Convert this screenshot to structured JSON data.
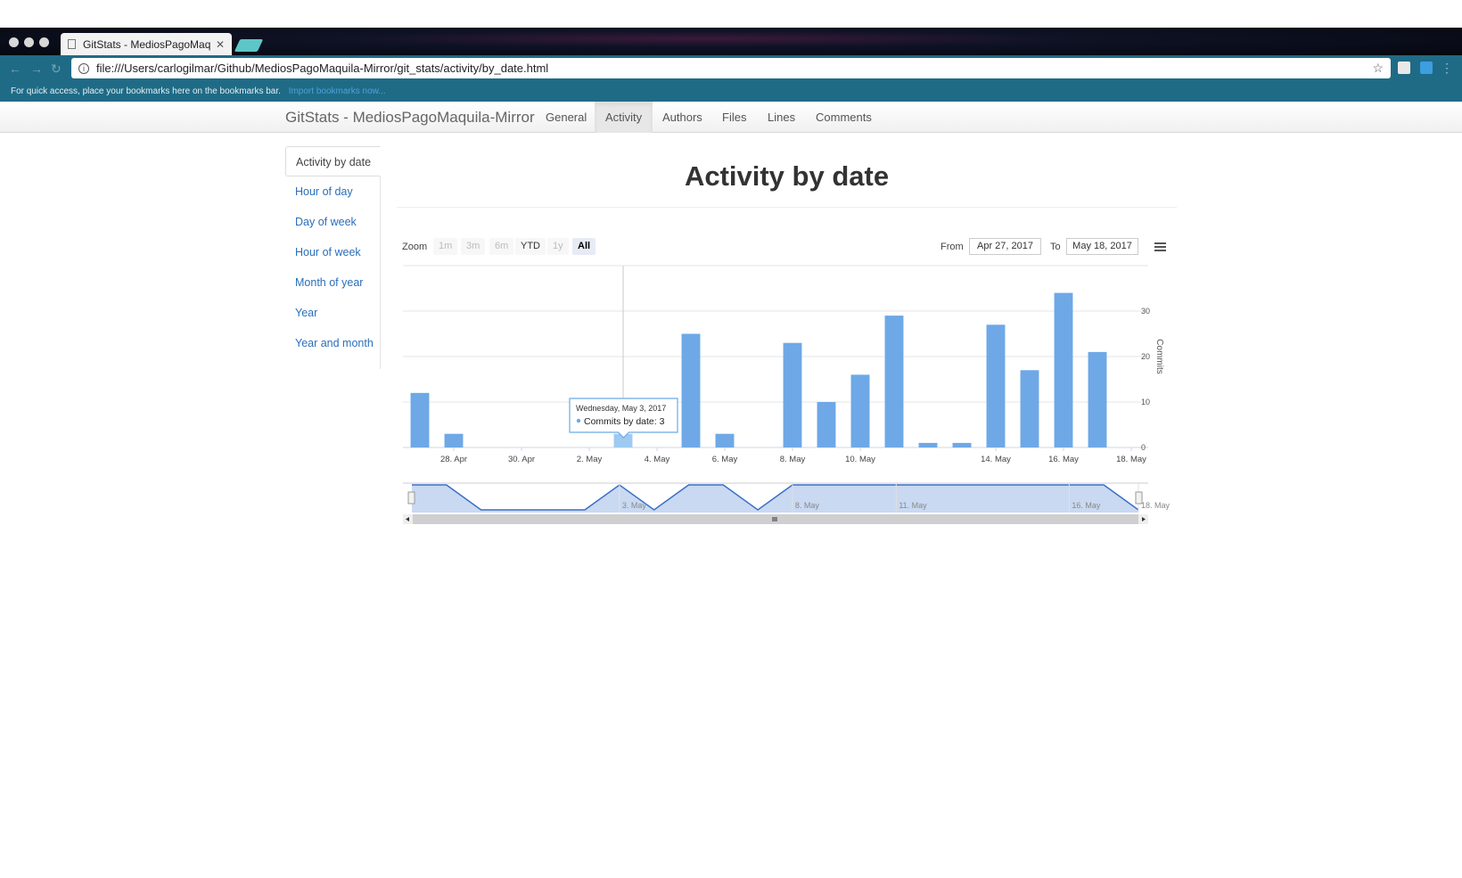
{
  "browser": {
    "tab_title": "GitStats - MediosPagoMaquila-Mirror",
    "url": "file:///Users/carlogilmar/Github/MediosPagoMaquila-Mirror/git_stats/activity/by_date.html",
    "bookmarks_text": "For quick access, place your bookmarks here on the bookmarks bar.",
    "bookmarks_link": "Import bookmarks now...",
    "nav_icons": [
      "back-icon",
      "forward-icon",
      "reload-icon"
    ]
  },
  "navbar": {
    "brand": "GitStats - MediosPagoMaquila-Mirror",
    "items": [
      {
        "label": "General"
      },
      {
        "label": "Activity",
        "active": true
      },
      {
        "label": "Authors"
      },
      {
        "label": "Files"
      },
      {
        "label": "Lines"
      },
      {
        "label": "Comments"
      }
    ]
  },
  "sidebar": {
    "items": [
      {
        "label": "Activity by date",
        "active": true
      },
      {
        "label": "Hour of day"
      },
      {
        "label": "Day of week"
      },
      {
        "label": "Hour of week"
      },
      {
        "label": "Month of year"
      },
      {
        "label": "Year"
      },
      {
        "label": "Year and month"
      }
    ]
  },
  "page": {
    "title": "Activity by date"
  },
  "range_selector": {
    "zoom_label": "Zoom",
    "buttons": [
      {
        "label": "1m",
        "enabled": false
      },
      {
        "label": "3m",
        "enabled": false
      },
      {
        "label": "6m",
        "enabled": false
      },
      {
        "label": "YTD",
        "enabled": true
      },
      {
        "label": "1y",
        "enabled": false
      },
      {
        "label": "All",
        "enabled": true,
        "selected": true
      }
    ],
    "from_label": "From",
    "from_value": "Apr 27, 2017",
    "to_label": "To",
    "to_value": "May 18, 2017"
  },
  "tooltip": {
    "date": "Wednesday, May 3, 2017",
    "series_label": "Commits by date",
    "value_text": "3"
  },
  "colors": {
    "bar": "#6ea8e6",
    "bar_highlight": "#9ecaf2",
    "navigator_fill": "#c9d9f2",
    "navigator_line": "#3a6fc4",
    "link": "#2a6fb8"
  },
  "chart_data": {
    "type": "bar",
    "title": "",
    "xlabel": "",
    "ylabel": "Commits",
    "ylim": [
      0,
      40
    ],
    "yticks": [
      "0",
      "10",
      "20",
      "30"
    ],
    "x_tick_labels": [
      "28. Apr",
      "30. Apr",
      "2. May",
      "4. May",
      "6. May",
      "8. May",
      "10. May",
      "14. May",
      "16. May",
      "18. May"
    ],
    "navigator_tick_labels": [
      "3. May",
      "8. May",
      "11. May",
      "16. May",
      "18. May"
    ],
    "x_range": [
      "2017-04-27",
      "2017-05-18"
    ],
    "grid": true,
    "series": [
      {
        "name": "Commits by date",
        "points": [
          {
            "date": "2017-04-27",
            "value": 12
          },
          {
            "date": "2017-04-28",
            "value": 3
          },
          {
            "date": "2017-05-03",
            "value": 3
          },
          {
            "date": "2017-05-05",
            "value": 25
          },
          {
            "date": "2017-05-06",
            "value": 3
          },
          {
            "date": "2017-05-08",
            "value": 23
          },
          {
            "date": "2017-05-09",
            "value": 10
          },
          {
            "date": "2017-05-10",
            "value": 16
          },
          {
            "date": "2017-05-11",
            "value": 29
          },
          {
            "date": "2017-05-12",
            "value": 1
          },
          {
            "date": "2017-05-13",
            "value": 1
          },
          {
            "date": "2017-05-14",
            "value": 27
          },
          {
            "date": "2017-05-15",
            "value": 17
          },
          {
            "date": "2017-05-16",
            "value": 34
          },
          {
            "date": "2017-05-17",
            "value": 21
          }
        ]
      }
    ],
    "highlighted_date": "2017-05-03"
  }
}
